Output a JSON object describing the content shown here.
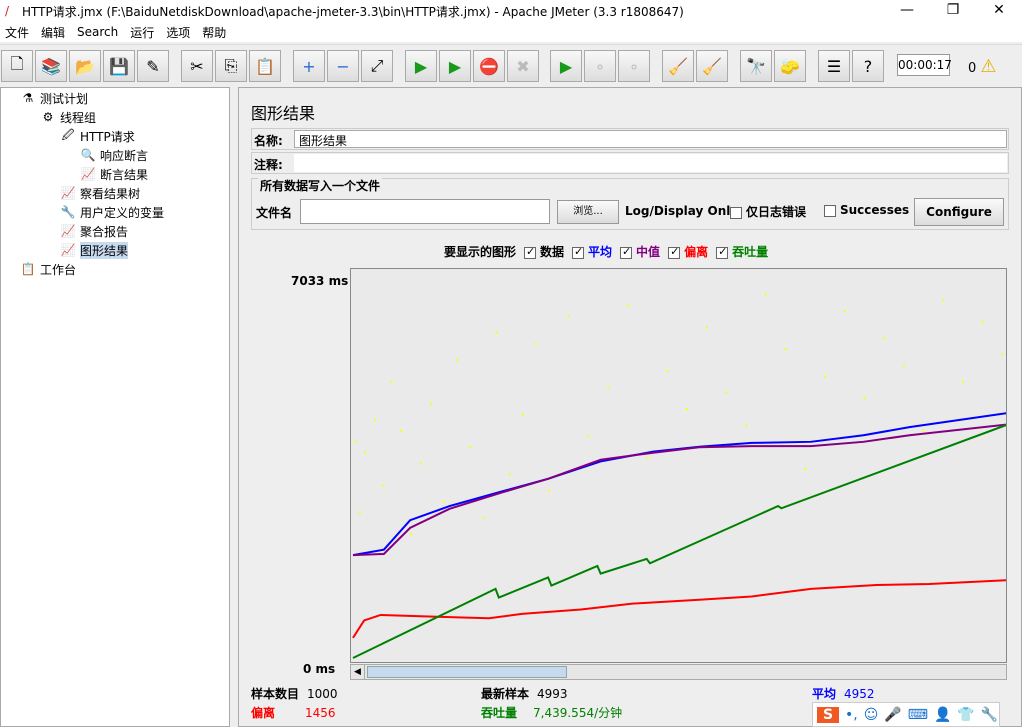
{
  "window": {
    "title": "HTTP请求.jmx (F:\\BaiduNetdiskDownload\\apache-jmeter-3.3\\bin\\HTTP请求.jmx) - Apache JMeter (3.3 r1808647)",
    "minimize": "—",
    "maximize": "❐",
    "close": "✕"
  },
  "menu": [
    "文件",
    "编辑",
    "Search",
    "运行",
    "选项",
    "帮助"
  ],
  "toolbar": {
    "icons": [
      "new",
      "templates",
      "open",
      "save",
      "save-as",
      "cut",
      "copy",
      "paste",
      "expand",
      "collapse",
      "toggle",
      "start",
      "start-no-pause",
      "stop",
      "shutdown",
      "remote-start",
      "remote-stop",
      "remote-shutdown",
      "clear",
      "clear-all",
      "search",
      "reset-search",
      "function-helper",
      "help"
    ],
    "timer": "00:00:17",
    "warnings": "0"
  },
  "tree": [
    {
      "label": "测试计划",
      "icon": "flask-icon",
      "level": 0
    },
    {
      "label": "线程组",
      "icon": "gear-icon",
      "level": 1
    },
    {
      "label": "HTTP请求",
      "icon": "pipette-icon",
      "level": 2
    },
    {
      "label": "响应断言",
      "icon": "magnifier-icon",
      "level": 3
    },
    {
      "label": "断言结果",
      "icon": "graph-icon",
      "level": 3
    },
    {
      "label": "察看结果树",
      "icon": "graph-icon",
      "level": 2
    },
    {
      "label": "用户定义的变量",
      "icon": "wrench-icon",
      "level": 2
    },
    {
      "label": "聚合报告",
      "icon": "graph-icon",
      "level": 2
    },
    {
      "label": "图形结果",
      "icon": "graph-icon",
      "level": 2,
      "selected": true
    },
    {
      "label": "工作台",
      "icon": "clipboard-icon",
      "level": 0
    }
  ],
  "panel": {
    "title": "图形结果",
    "name_label": "名称:",
    "name_value": "图形结果",
    "comment_label": "注释:",
    "comment_value": "",
    "file_group": "所有数据写入一个文件",
    "filename_label": "文件名",
    "filename_value": "",
    "browse": "浏览...",
    "log_display": "Log/Display Only:",
    "errors_only": "仅日志错误",
    "successes": "Successes",
    "configure": "Configure",
    "graphs_label": "要显示的图形",
    "graphs": [
      {
        "label": "数据",
        "color": "#000000",
        "checked": true
      },
      {
        "label": "平均",
        "color": "#0000ff",
        "checked": true
      },
      {
        "label": "中值",
        "color": "#800080",
        "checked": true
      },
      {
        "label": "偏离",
        "color": "#ff0000",
        "checked": true
      },
      {
        "label": "吞吐量",
        "color": "#008000",
        "checked": true
      }
    ]
  },
  "chart_data": {
    "type": "line",
    "ymax_label": "7033 ms",
    "ymin_label": "0 ms",
    "ylim": [
      0,
      7033
    ],
    "xlim": [
      0,
      1000
    ],
    "series": [
      {
        "name": "平均",
        "color": "#0000ff",
        "x": [
          3,
          50,
          90,
          150,
          230,
          300,
          380,
          460,
          530,
          610,
          700,
          780,
          850,
          1000
        ],
        "y": [
          2000,
          2100,
          2640,
          2900,
          3170,
          3400,
          3720,
          3900,
          3990,
          4060,
          4080,
          4200,
          4350,
          4610
        ]
      },
      {
        "name": "中值",
        "color": "#800080",
        "x": [
          3,
          50,
          90,
          150,
          230,
          300,
          380,
          460,
          530,
          610,
          700,
          780,
          850,
          1000
        ],
        "y": [
          2000,
          2020,
          2500,
          2850,
          3150,
          3400,
          3750,
          3880,
          3980,
          4000,
          4000,
          4080,
          4200,
          4400
        ]
      },
      {
        "name": "偏离",
        "color": "#ff0000",
        "x": [
          3,
          20,
          45,
          100,
          150,
          210,
          260,
          350,
          430,
          530,
          610,
          700,
          800,
          880,
          1000
        ],
        "y": [
          480,
          800,
          900,
          880,
          860,
          840,
          920,
          1000,
          1110,
          1180,
          1240,
          1380,
          1450,
          1470,
          1540
        ]
      },
      {
        "name": "吞吐量",
        "color": "#008000",
        "x": [
          3,
          220,
          225,
          300,
          305,
          375,
          380,
          450,
          455,
          650,
          655,
          1000
        ],
        "y": [
          110,
          1380,
          1220,
          1590,
          1440,
          1800,
          1660,
          1930,
          1850,
          2900,
          2860,
          4400
        ]
      }
    ],
    "data_points": {
      "color": "#ffff00",
      "x": [
        5,
        12,
        20,
        35,
        48,
        60,
        75,
        90,
        105,
        120,
        140,
        160,
        180,
        200,
        220,
        240,
        260,
        280,
        300,
        330,
        360,
        390,
        420,
        450,
        480,
        510,
        540,
        570,
        600,
        630,
        660,
        690,
        720,
        750,
        780,
        810,
        840,
        870,
        900,
        930,
        960,
        990
      ],
      "y": [
        4100,
        2800,
        3900,
        4500,
        3300,
        5200,
        4300,
        2400,
        3700,
        4800,
        3000,
        5600,
        4000,
        2700,
        6100,
        3500,
        4600,
        5900,
        3200,
        6400,
        4200,
        5100,
        6600,
        3800,
        5400,
        4700,
        6200,
        5000,
        4400,
        6800,
        5800,
        3600,
        5300,
        6500,
        4900,
        6000,
        5500,
        4300,
        6700,
        5200,
        6300,
        5700
      ]
    }
  },
  "stats": {
    "samples_label": "样本数目",
    "samples": "1000",
    "latest_label": "最新样本",
    "latest": "4993",
    "avg_label": "平均",
    "avg": "4952",
    "dev_label": "偏离",
    "dev": "1456",
    "tp_label": "吞吐量",
    "tp": "7,439.554/分钟"
  },
  "colors": {
    "avg": "#0000ff",
    "median": "#800080",
    "deviation": "#ff0000",
    "throughput": "#008000",
    "data": "#ffff00"
  }
}
